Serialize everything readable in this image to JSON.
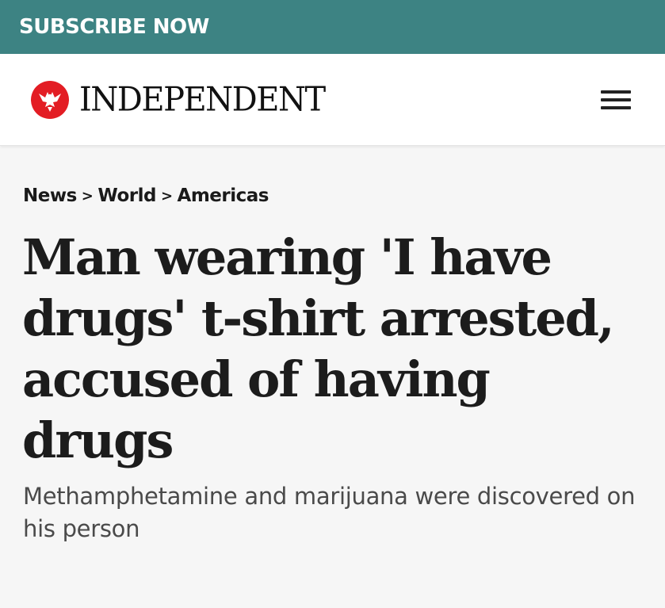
{
  "subscribe_bar": {
    "label": "SUBSCRIBE NOW",
    "background": "#3d8383"
  },
  "masthead": {
    "logo_icon": "eagle-icon",
    "logo_color": "#e31d24",
    "brand_name": "INDEPENDENT",
    "menu_icon": "hamburger-menu-icon"
  },
  "breadcrumb": {
    "items": [
      "News",
      "World",
      "Americas"
    ],
    "separator": ">"
  },
  "article": {
    "headline": "Man wearing 'I have drugs' t-shirt arrested, accused of having drugs",
    "standfirst": "Methamphetamine and marijuana were discovered on his person"
  }
}
